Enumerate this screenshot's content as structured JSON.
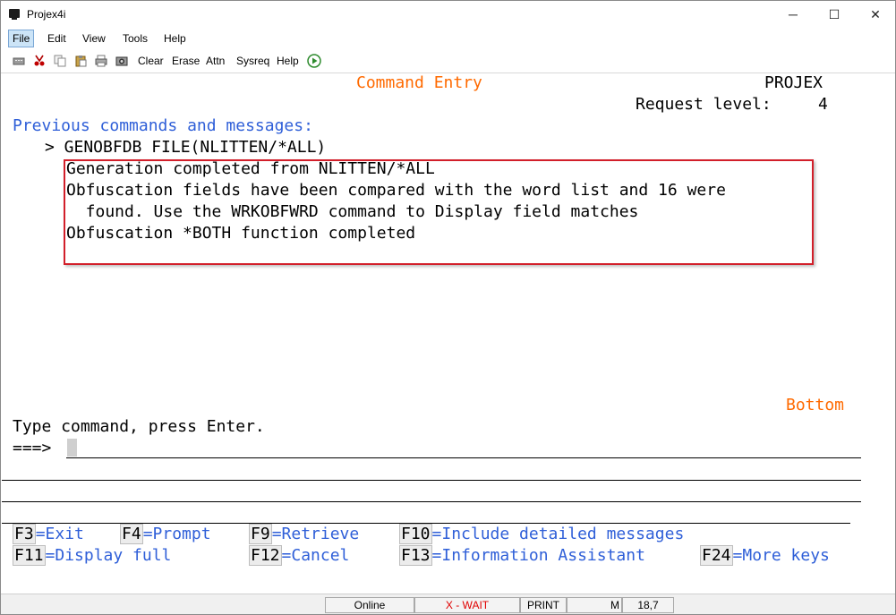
{
  "window": {
    "title": "Projex4i",
    "min_glyph": "─",
    "max_glyph": "☐",
    "close_glyph": "✕"
  },
  "menu": {
    "items": [
      "File",
      "Edit",
      "View",
      "Tools",
      "Help"
    ]
  },
  "toolbar": {
    "buttons": [
      "Clear",
      "Erase",
      "Attn",
      "Sysreq",
      "Help"
    ],
    "icons": [
      "keyboard-icon",
      "cut-icon",
      "copy-icon",
      "paste-icon",
      "print-icon",
      "screenshot-icon",
      "play-icon"
    ]
  },
  "screen": {
    "title": "Command Entry",
    "system": "PROJEX",
    "request_level_label": "Request level:",
    "request_level": "4",
    "section_heading": "Previous commands and messages:",
    "command_line": "> GENOBFDB FILE(NLITTEN/*ALL)",
    "messages": [
      "Generation completed from NLITTEN/*ALL",
      "Obfuscation fields have been compared with the word list and 16 were",
      "  found. Use the WRKOBFWRD command to Display field matches",
      "Obfuscation *BOTH function completed"
    ],
    "bottom_label": "Bottom",
    "prompt": "Type command, press Enter.",
    "input_marker": "===>",
    "command_value": ""
  },
  "function_keys": {
    "f3": {
      "key": "F3",
      "label": "=Exit"
    },
    "f4": {
      "key": "F4",
      "label": "=Prompt"
    },
    "f9": {
      "key": "F9",
      "label": "=Retrieve"
    },
    "f10": {
      "key": "F10",
      "label": "=Include detailed messages"
    },
    "f11": {
      "key": "F11",
      "label": "=Display full"
    },
    "f12": {
      "key": "F12",
      "label": "=Cancel"
    },
    "f13": {
      "key": "F13",
      "label": "=Information Assistant"
    },
    "f24": {
      "key": "F24",
      "label": "=More keys"
    }
  },
  "status": {
    "online": "Online",
    "wait": "X - WAIT",
    "print": "PRINT",
    "mode": "M",
    "cursor": "18,7"
  },
  "colors": {
    "orange": "#ff6a00",
    "blue": "#2f5fd8",
    "highlight_border": "#d21f2a",
    "wait_red": "#e00000"
  }
}
